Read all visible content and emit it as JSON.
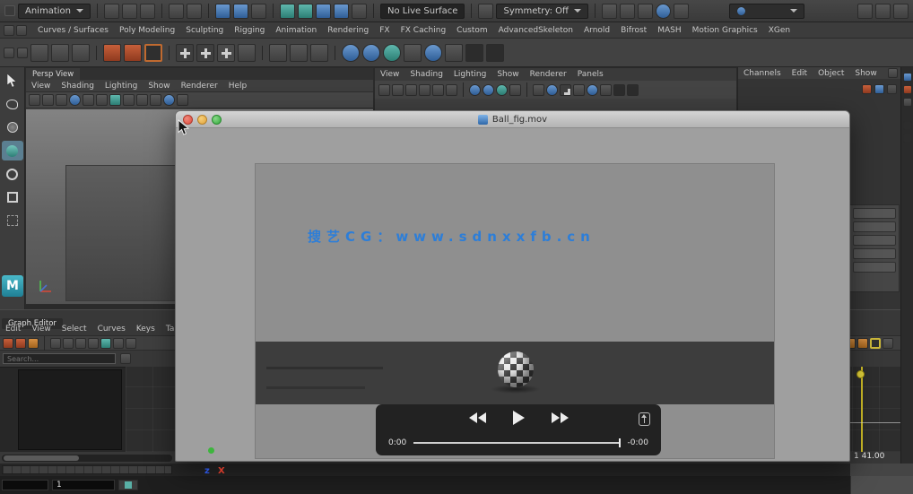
{
  "app": {
    "logo_letter": "M",
    "menuset": "Animation",
    "live_surface": "No Live Surface",
    "symmetry": "Symmetry: Off"
  },
  "shelf": {
    "tabs": [
      "Curves / Surfaces",
      "Poly Modeling",
      "Sculpting",
      "Rigging",
      "Animation",
      "Rendering",
      "FX",
      "FX Caching",
      "Custom",
      "AdvancedSkeleton",
      "Arnold",
      "Bifrost",
      "MASH",
      "Motion Graphics",
      "XGen"
    ]
  },
  "persp_panel": {
    "title": "Persp View",
    "menus": [
      "View",
      "Shading",
      "Lighting",
      "Show",
      "Renderer",
      "Help"
    ]
  },
  "viewport_menu": {
    "items": [
      "View",
      "Shading",
      "Lighting",
      "Show",
      "Renderer",
      "Panels"
    ]
  },
  "channel_box": {
    "menus": [
      "Channels",
      "Edit",
      "Object",
      "Show"
    ]
  },
  "graph_editor": {
    "title": "Graph Editor",
    "menus": [
      "Edit",
      "View",
      "Select",
      "Curves",
      "Keys",
      "Tangents"
    ],
    "search_placeholder": "Search...",
    "range_label": "1 41.00"
  },
  "player": {
    "title": "Ball_fig.mov",
    "watermark": "搜艺CG：www.sdnxxfb.cn",
    "time_elapsed": "0:00",
    "time_remaining": "-0:00"
  },
  "timeline": {
    "current_frame": "1"
  },
  "axis_overlay": {
    "z": "z",
    "x": "X"
  }
}
